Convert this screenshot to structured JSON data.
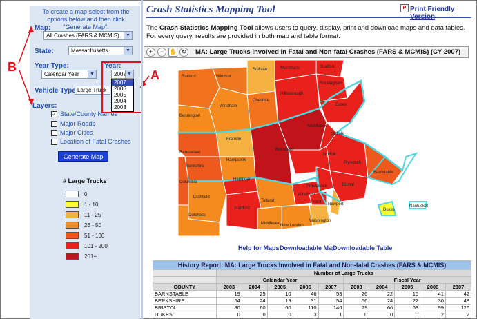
{
  "sidebar": {
    "intro": "To create a map select from the options below and then click \"Generate Map\".",
    "map_label": "Map:",
    "map_value": "All Crashes (FARS & MCMIS)",
    "state_label": "State:",
    "state_value": "Massachusetts",
    "year_type_label": "Year Type:",
    "year_type_value": "Calendar Year",
    "year_label": "Year:",
    "year_value": "2007",
    "year_options": [
      "2007",
      "2006",
      "2005",
      "2004",
      "2003"
    ],
    "vehicle_type_label": "Vehicle Type:",
    "vehicle_type_value": "Large Truck",
    "layers_label": "Layers:",
    "layers": [
      {
        "label": "State/County Names",
        "checked": true
      },
      {
        "label": "Major Roads",
        "checked": false
      },
      {
        "label": "Major Cities",
        "checked": false
      },
      {
        "label": "Location of Fatal Crashes",
        "checked": false
      }
    ],
    "generate_button": "Generate Map",
    "legend_title": "# Large Trucks",
    "legend": [
      {
        "label": "0",
        "color": "#ffffff"
      },
      {
        "label": "1 - 10",
        "color": "#ffff33"
      },
      {
        "label": "11 - 25",
        "color": "#f5b240"
      },
      {
        "label": "26 - 50",
        "color": "#f58a1f"
      },
      {
        "label": "51 - 100",
        "color": "#ee5a1e"
      },
      {
        "label": "101 - 200",
        "color": "#e8211c"
      },
      {
        "label": "201+",
        "color": "#c0141a"
      }
    ]
  },
  "annotations": {
    "a": "A",
    "b": "B"
  },
  "header": {
    "title": "Crash Statistics Mapping Tool",
    "print_link": "Print Friendly Version",
    "description_bold": "Crash Statistics Mapping Tool",
    "description_pre": "The ",
    "description_post": " allows users to query, display, print and download maps and data tables. For every query, results are provided in both map and table format."
  },
  "map": {
    "title": "MA: Large Trucks Involved in Fatal and Non-fatal Crashes (FARS & MCMIS) (CY 2007)",
    "tools": [
      "zoom-in-icon",
      "zoom-out-icon",
      "pan-hand-icon",
      "refresh-icon"
    ],
    "labels": [
      "Rutland",
      "Windsor",
      "Sullivan",
      "Merrimack",
      "Strafford",
      "Rockingham",
      "Hillsborough",
      "Cheshire",
      "Windham",
      "Bennington",
      "Essex",
      "Franklin",
      "Middlesex",
      "Rensselaer",
      "Hampshire",
      "Worcester",
      "Suffolk",
      "Berkshire",
      "Norfolk",
      "Plymouth",
      "Columbia",
      "Hampden",
      "Windham",
      "Providence",
      "Barnstable",
      "Bristol",
      "Tolland",
      "Kent",
      "Newport",
      "Litchfield",
      "Hartford",
      "Dukes",
      "Nantucket",
      "Dutchess",
      "Middlesex",
      "New London",
      "Washington"
    ],
    "links": [
      "Help for Maps",
      "Downloadable Map",
      "Downloadable Table"
    ]
  },
  "report": {
    "title": "History Report: MA: Large Trucks Involved in Fatal and Non-fatal Crashes (FARS & MCMIS)",
    "group_header": "Number of Large Trucks",
    "calendar_label": "Calendar Year",
    "fiscal_label": "Fiscal Year",
    "county_label": "COUNTY",
    "years": [
      "2003",
      "2004",
      "2005",
      "2006",
      "2007",
      "2003",
      "2004",
      "2005",
      "2006",
      "2007"
    ],
    "rows": [
      {
        "county": "BARNSTABLE",
        "values": [
          "19",
          "25",
          "10",
          "46",
          "53",
          "26",
          "22",
          "15",
          "41",
          "42"
        ]
      },
      {
        "county": "BERKSHIRE",
        "values": [
          "54",
          "24",
          "19",
          "31",
          "54",
          "56",
          "24",
          "22",
          "30",
          "48"
        ]
      },
      {
        "county": "BRISTOL",
        "values": [
          "80",
          "60",
          "60",
          "110",
          "146",
          "79",
          "66",
          "63",
          "99",
          "126"
        ]
      },
      {
        "county": "DUKES",
        "values": [
          "0",
          "0",
          "0",
          "3",
          "1",
          "0",
          "0",
          "0",
          "2",
          "2"
        ]
      }
    ]
  }
}
